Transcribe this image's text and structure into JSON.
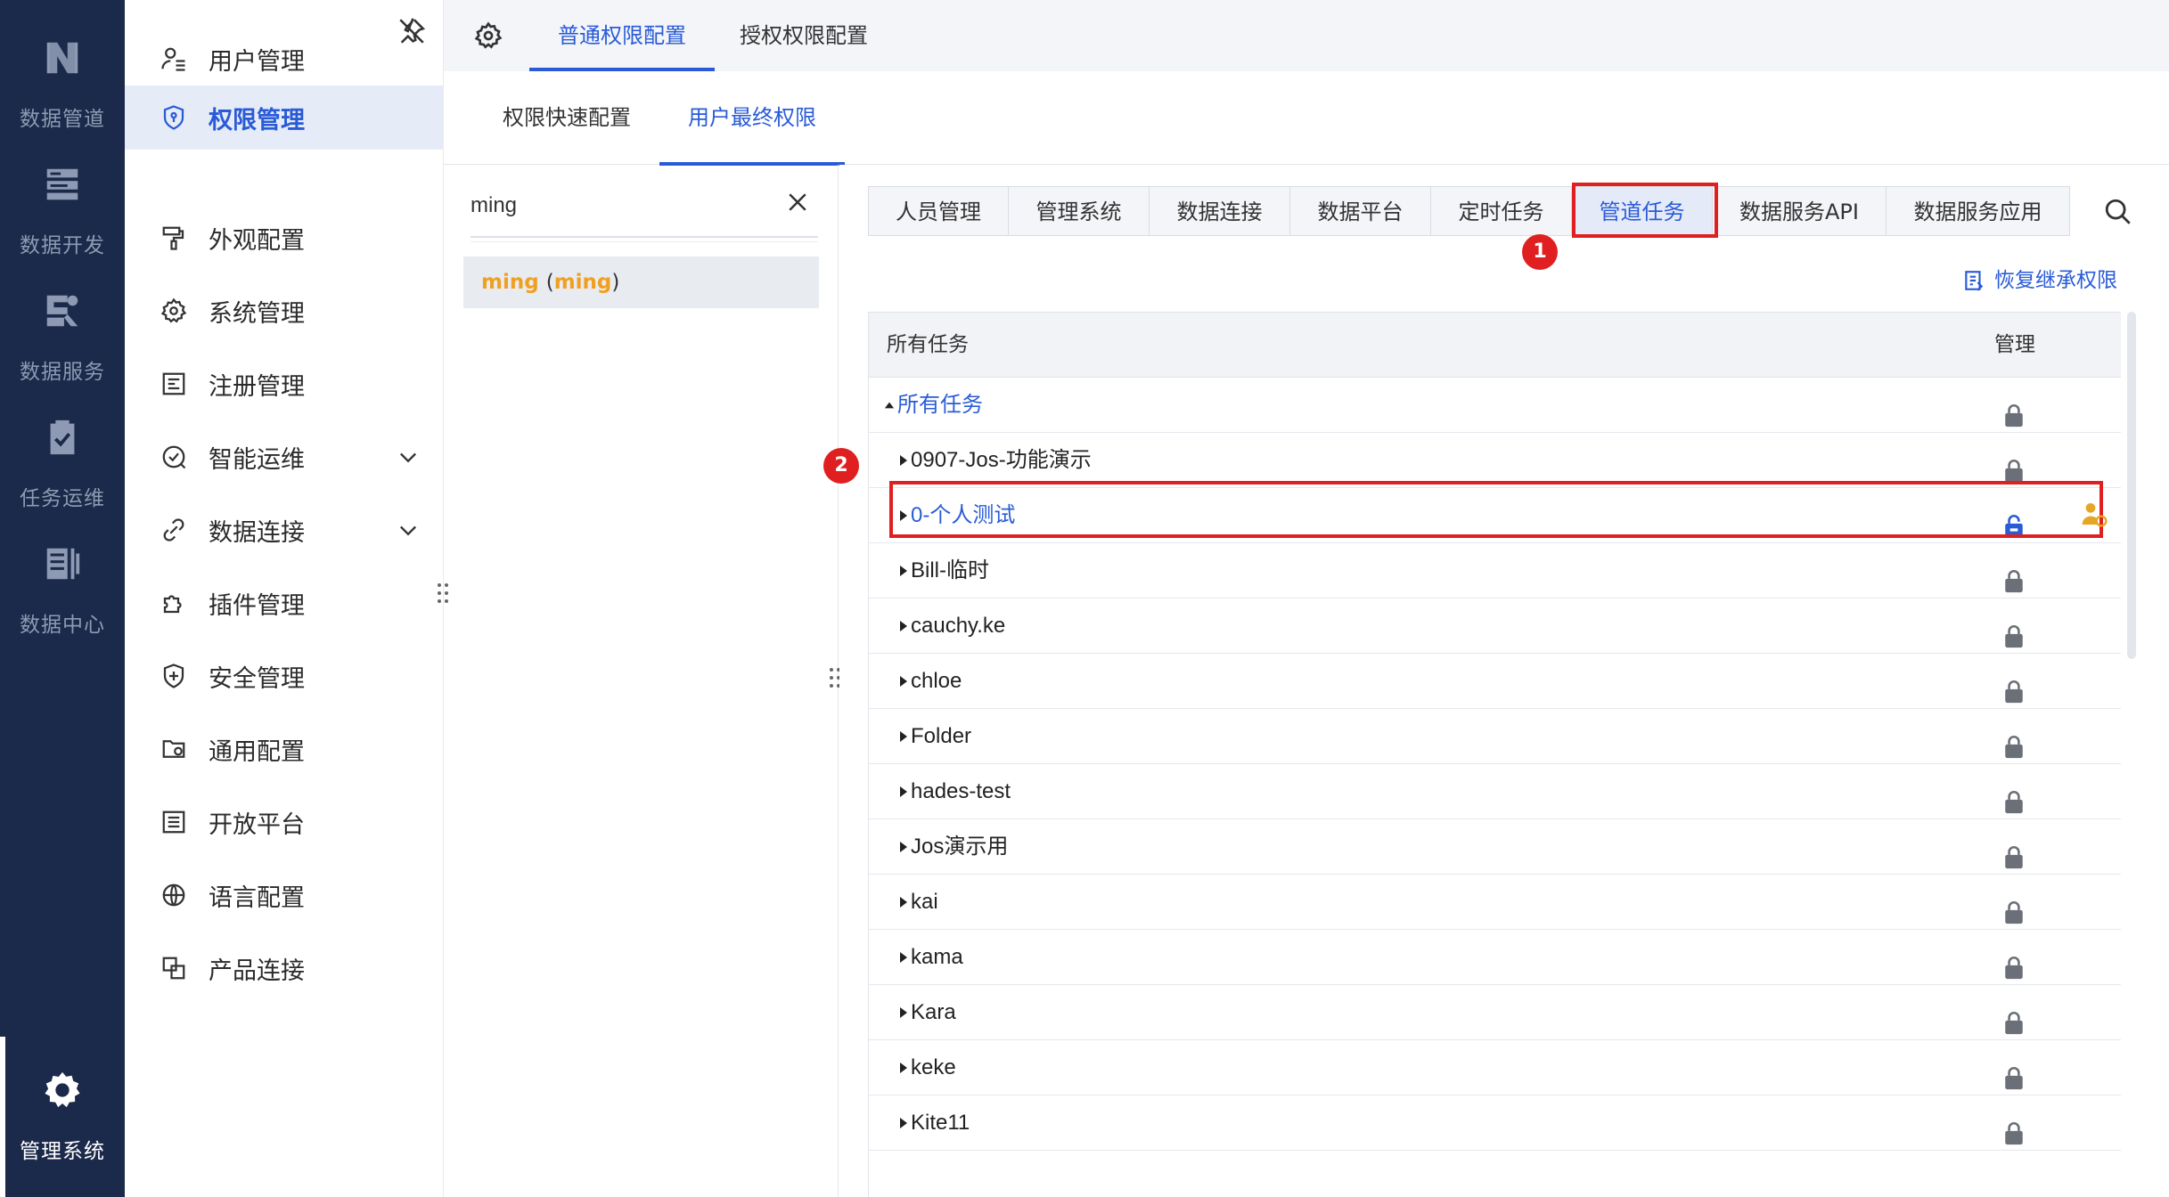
{
  "rail": {
    "items": [
      {
        "label": "数据管道",
        "icon": "pipeline-icon"
      },
      {
        "label": "数据开发",
        "icon": "dev-icon"
      },
      {
        "label": "数据服务",
        "icon": "service-icon"
      },
      {
        "label": "任务运维",
        "icon": "task-ops-icon"
      },
      {
        "label": "数据中心",
        "icon": "data-center-icon"
      },
      {
        "label": "管理系统",
        "icon": "gear-icon",
        "active": true
      }
    ]
  },
  "nav": {
    "items": [
      {
        "label": "用户管理",
        "icon": "user-icon"
      },
      {
        "label": "权限管理",
        "icon": "shield-icon",
        "active": true
      },
      {
        "label": "外观配置",
        "icon": "paint-roller-icon"
      },
      {
        "label": "系统管理",
        "icon": "gear-icon"
      },
      {
        "label": "注册管理",
        "icon": "register-icon"
      },
      {
        "label": "智能运维",
        "icon": "smart-ops-icon",
        "expandable": true
      },
      {
        "label": "数据连接",
        "icon": "link-icon",
        "expandable": true
      },
      {
        "label": "插件管理",
        "icon": "puzzle-icon"
      },
      {
        "label": "安全管理",
        "icon": "security-icon"
      },
      {
        "label": "通用配置",
        "icon": "folder-gear-icon"
      },
      {
        "label": "开放平台",
        "icon": "list-icon"
      },
      {
        "label": "语言配置",
        "icon": "globe-icon"
      },
      {
        "label": "产品连接",
        "icon": "connect-icon"
      }
    ]
  },
  "header": {
    "tabs": [
      {
        "label": "普通权限配置",
        "active": true
      },
      {
        "label": "授权权限配置"
      }
    ]
  },
  "subtabs": [
    {
      "label": "权限快速配置"
    },
    {
      "label": "用户最终权限",
      "active": true
    }
  ],
  "user_search": {
    "value": "ming",
    "result_name": "ming",
    "result_id": "ming",
    "paren_open": "(",
    "paren_close": ")"
  },
  "categories": [
    {
      "label": "人员管理"
    },
    {
      "label": "管理系统"
    },
    {
      "label": "数据连接"
    },
    {
      "label": "数据平台"
    },
    {
      "label": "定时任务"
    },
    {
      "label": "管道任务",
      "active": true
    },
    {
      "label": "数据服务API"
    },
    {
      "label": "数据服务应用"
    }
  ],
  "annotations": {
    "badge1": "1",
    "badge2": "2"
  },
  "restore_label": "恢复继承权限",
  "table": {
    "col_name": "所有任务",
    "col_manage": "管理",
    "rows": [
      {
        "label": "所有任务",
        "level": 0,
        "expanded": true,
        "blue": true,
        "lock": "locked"
      },
      {
        "label": "0907-Jos-功能演示",
        "level": 1,
        "lock": "locked"
      },
      {
        "label": "0-个人测试",
        "level": 1,
        "blue": true,
        "lock": "unlocked",
        "user_marker": true
      },
      {
        "label": "Bill-临时",
        "level": 1,
        "lock": "locked"
      },
      {
        "label": "cauchy.ke",
        "level": 1,
        "lock": "locked"
      },
      {
        "label": "chloe",
        "level": 1,
        "lock": "locked"
      },
      {
        "label": "Folder",
        "level": 1,
        "lock": "locked"
      },
      {
        "label": "hades-test",
        "level": 1,
        "lock": "locked"
      },
      {
        "label": "Jos演示用",
        "level": 1,
        "lock": "locked"
      },
      {
        "label": "kai",
        "level": 1,
        "lock": "locked"
      },
      {
        "label": "kama",
        "level": 1,
        "lock": "locked"
      },
      {
        "label": "Kara",
        "level": 1,
        "lock": "locked"
      },
      {
        "label": "keke",
        "level": 1,
        "lock": "locked"
      },
      {
        "label": "Kite11",
        "level": 1,
        "lock": "locked"
      }
    ]
  },
  "colors": {
    "accent": "#2a5bd7",
    "rail_bg": "#1b2a4a",
    "highlight": "#e02020",
    "user_name": "#f0a020"
  }
}
